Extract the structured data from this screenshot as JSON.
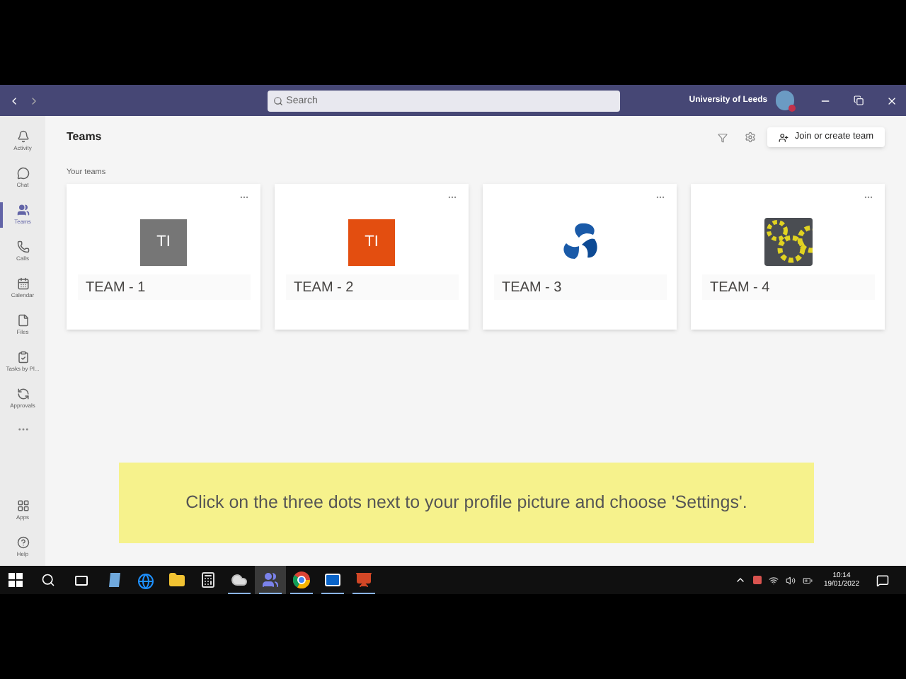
{
  "title_bar": {
    "search": {
      "placeholder": "Search"
    },
    "org": "University of Leeds"
  },
  "sidebar": {
    "items": [
      {
        "label": "Activity",
        "selected": false
      },
      {
        "label": "Chat",
        "selected": false
      },
      {
        "label": "Teams",
        "selected": true
      },
      {
        "label": "Calls",
        "selected": false
      },
      {
        "label": "Calendar",
        "selected": false
      },
      {
        "label": "Files",
        "selected": false
      },
      {
        "label": "Tasks by Pl...",
        "selected": false
      },
      {
        "label": "Approvals",
        "selected": false
      }
    ],
    "bottom_items": [
      {
        "label": "Apps"
      },
      {
        "label": "Help"
      }
    ]
  },
  "header": {
    "title": "Teams",
    "button": "Join or create team"
  },
  "section_title": "Your teams",
  "teams": [
    {
      "name": "TEAM - 1",
      "kind": "initials",
      "initials": "TI",
      "color": "#767676"
    },
    {
      "name": "TEAM - 2",
      "kind": "initials",
      "initials": "TI",
      "color": "#e34e10"
    },
    {
      "name": "TEAM - 3",
      "kind": "swirl"
    },
    {
      "name": "TEAM - 4",
      "kind": "gears"
    }
  ],
  "caption": "Click on the three dots next to your profile picture and choose 'Settings'.",
  "taskbar": {
    "apps": [
      {
        "selected": false,
        "running": false
      },
      {
        "selected": false,
        "running": false
      },
      {
        "selected": false,
        "running": false
      },
      {
        "selected": false,
        "running": false
      },
      {
        "selected": false,
        "running": true
      },
      {
        "selected": true,
        "running": true
      },
      {
        "selected": false,
        "running": true
      },
      {
        "selected": false,
        "running": true
      },
      {
        "selected": false,
        "running": true
      }
    ],
    "time": "10:14",
    "date": "19/01/2022"
  }
}
